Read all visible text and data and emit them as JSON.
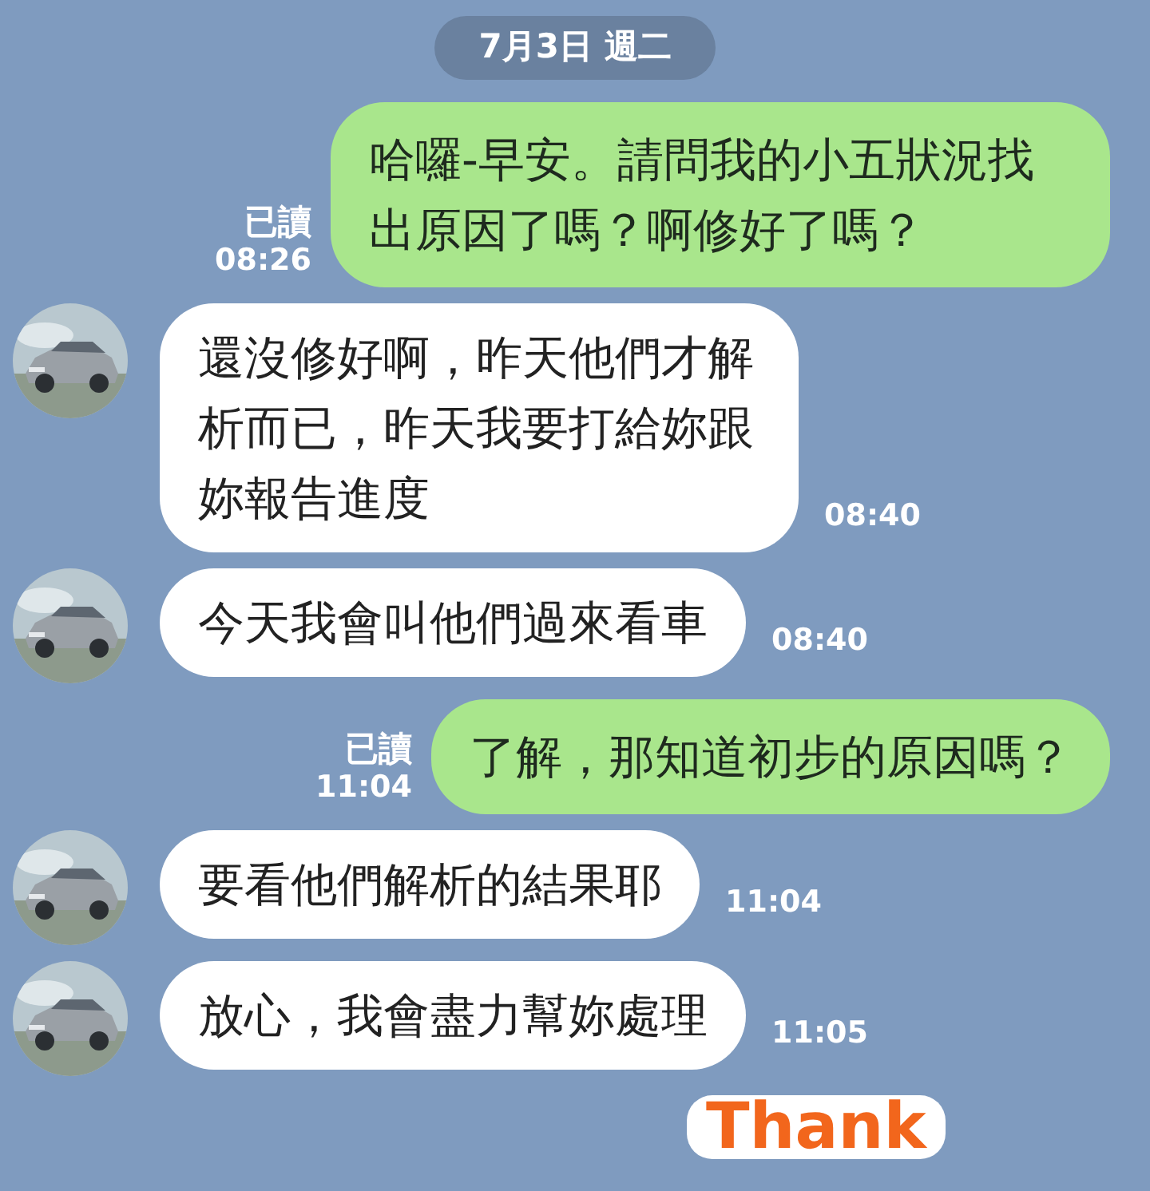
{
  "date_separator": "7月3日 週二",
  "messages": [
    {
      "kind": "sent",
      "text": "哈囉-早安。請問我的小五狀況找出原因了嗎？啊修好了嗎？",
      "read_receipt": "已讀",
      "time": "08:26"
    },
    {
      "kind": "received",
      "text": "還沒修好啊，昨天他們才解析而已，昨天我要打給妳跟妳報告進度",
      "time": "08:40"
    },
    {
      "kind": "received",
      "text": "今天我會叫他們過來看車",
      "time": "08:40"
    },
    {
      "kind": "sent",
      "text": "了解，那知道初步的原因嗎？",
      "read_receipt": "已讀",
      "time": "11:04"
    },
    {
      "kind": "received",
      "text": "要看他們解析的結果耶",
      "time": "11:04"
    },
    {
      "kind": "received",
      "text": "放心，我會盡力幫妳處理",
      "time": "11:05"
    },
    {
      "kind": "sticker",
      "text": "Thank"
    }
  ]
}
